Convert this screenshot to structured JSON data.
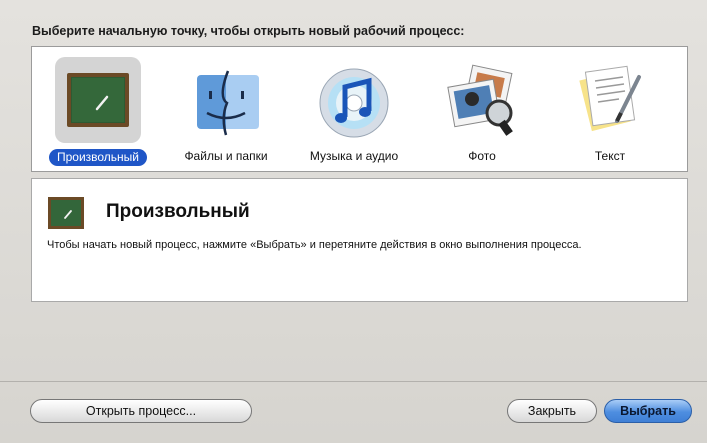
{
  "prompt": "Выберите начальную точку, чтобы открыть новый рабочий процесс:",
  "starting_points": [
    {
      "label": "Произвольный",
      "icon": "chalkboard-icon",
      "selected": true
    },
    {
      "label": "Файлы и папки",
      "icon": "finder-icon",
      "selected": false
    },
    {
      "label": "Музыка и аудио",
      "icon": "itunes-music-icon",
      "selected": false
    },
    {
      "label": "Фото",
      "icon": "photos-icon",
      "selected": false
    },
    {
      "label": "Текст",
      "icon": "text-document-icon",
      "selected": false
    }
  ],
  "info": {
    "icon": "chalkboard-icon",
    "title": "Произвольный",
    "description": "Чтобы начать новый процесс, нажмите «Выбрать» и перетяните действия в окно выполнения процесса."
  },
  "buttons": {
    "open": "Открыть процесс...",
    "close": "Закрыть",
    "choose": "Выбрать"
  },
  "colors": {
    "selection": "#1f56c7",
    "default_button": "#4e8ee0"
  }
}
